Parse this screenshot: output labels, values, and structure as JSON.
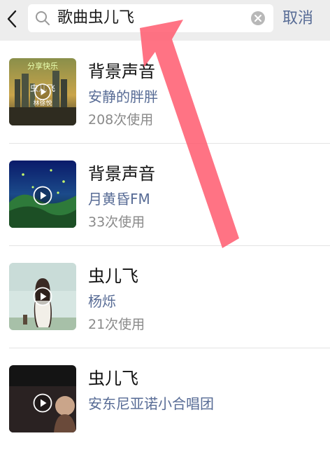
{
  "search": {
    "query": "歌曲虫儿飞",
    "cancel_label": "取消"
  },
  "icons": {
    "back": "chevron-left-icon",
    "search": "search-icon",
    "clear": "clear-icon",
    "play": "play-icon"
  },
  "colors": {
    "accent": "#576b95",
    "annotation_arrow": "#ff5a6e"
  },
  "results": [
    {
      "title": "背景声音",
      "artist": "安静的胖胖",
      "usage": "208次使用",
      "cover_text": [
        "分享快乐",
        "虫儿飞",
        "林徐悦"
      ]
    },
    {
      "title": "背景声音",
      "artist": "月黄昏FM",
      "usage": "33次使用"
    },
    {
      "title": "虫儿飞",
      "artist": "杨烁",
      "usage": "21次使用"
    },
    {
      "title": "虫儿飞",
      "artist": "安东尼亚诺小合唱团",
      "usage": ""
    }
  ]
}
